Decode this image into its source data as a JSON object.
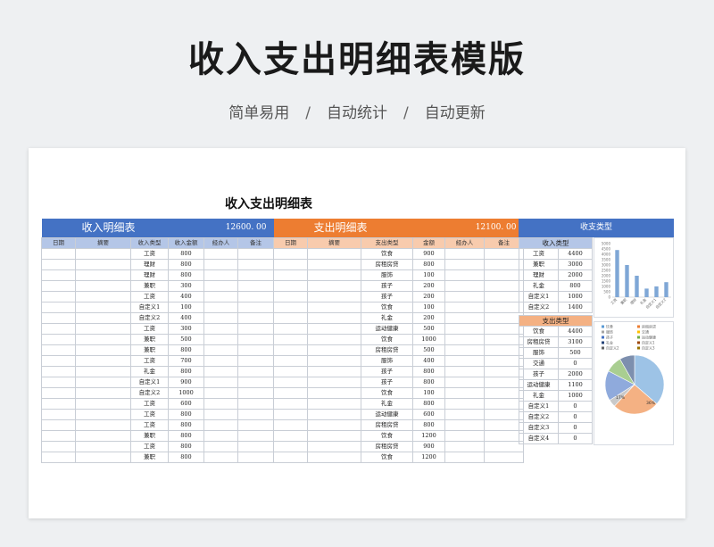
{
  "header": {
    "title": "收入支出明细表模版",
    "tags": [
      "简单易用",
      "自动统计",
      "自动更新"
    ],
    "separator": "/"
  },
  "sheet": {
    "title": "收入支出明细表"
  },
  "income": {
    "banner": "收入明细表",
    "total": "12600. 00",
    "columns": [
      "日期",
      "摘要",
      "收入类型",
      "收入金额",
      "经办人",
      "备注"
    ],
    "rows": [
      [
        "工资",
        "800"
      ],
      [
        "理财",
        "800"
      ],
      [
        "理财",
        "800"
      ],
      [
        "兼职",
        "300"
      ],
      [
        "工资",
        "400"
      ],
      [
        "自定义1",
        "100"
      ],
      [
        "自定义2",
        "400"
      ],
      [
        "工资",
        "300"
      ],
      [
        "兼职",
        "500"
      ],
      [
        "兼职",
        "800"
      ],
      [
        "工资",
        "700"
      ],
      [
        "礼金",
        "800"
      ],
      [
        "自定义1",
        "900"
      ],
      [
        "自定义2",
        "1000"
      ],
      [
        "工资",
        "600"
      ],
      [
        "工资",
        "800"
      ],
      [
        "工资",
        "800"
      ],
      [
        "兼职",
        "800"
      ],
      [
        "工资",
        "800"
      ],
      [
        "兼职",
        "800"
      ]
    ]
  },
  "expense": {
    "banner": "支出明细表",
    "total": "12100. 00",
    "columns": [
      "日期",
      "摘要",
      "支出类型",
      "金额",
      "经办人",
      "备注"
    ],
    "rows": [
      [
        "饮食",
        "900"
      ],
      [
        "房租房贷",
        "800"
      ],
      [
        "服饰",
        "100"
      ],
      [
        "孩子",
        "200"
      ],
      [
        "孩子",
        "200"
      ],
      [
        "饮食",
        "100"
      ],
      [
        "礼金",
        "200"
      ],
      [
        "运动健康",
        "500"
      ],
      [
        "饮食",
        "1000"
      ],
      [
        "房租房贷",
        "500"
      ],
      [
        "服饰",
        "400"
      ],
      [
        "孩子",
        "800"
      ],
      [
        "孩子",
        "800"
      ],
      [
        "饮食",
        "100"
      ],
      [
        "礼金",
        "800"
      ],
      [
        "运动健康",
        "600"
      ],
      [
        "房租房贷",
        "800"
      ],
      [
        "饮食",
        "1200"
      ],
      [
        "房租房贷",
        "900"
      ],
      [
        "饮食",
        "1200"
      ]
    ]
  },
  "summary": {
    "banner": "收支类型",
    "income_label": "收入类型",
    "income_types": [
      [
        "工资",
        "4400"
      ],
      [
        "兼职",
        "3000"
      ],
      [
        "理财",
        "2000"
      ],
      [
        "礼金",
        "800"
      ],
      [
        "自定义1",
        "1000"
      ],
      [
        "自定义2",
        "1400"
      ]
    ],
    "expense_label": "支出类型",
    "expense_types": [
      [
        "饮食",
        "4400"
      ],
      [
        "房租房贷",
        "3100"
      ],
      [
        "服饰",
        "500"
      ],
      [
        "交通",
        "0"
      ],
      [
        "孩子",
        "2000"
      ],
      [
        "运动健康",
        "1100"
      ],
      [
        "礼金",
        "1000"
      ],
      [
        "自定义1",
        "0"
      ],
      [
        "自定义2",
        "0"
      ],
      [
        "自定义3",
        "0"
      ],
      [
        "自定义4",
        "0"
      ]
    ]
  },
  "chart_data": [
    {
      "type": "bar",
      "categories": [
        "工资",
        "兼职",
        "理财",
        "礼金",
        "自定义1",
        "自定义2"
      ],
      "values": [
        4400,
        3000,
        2000,
        800,
        1000,
        1400
      ],
      "ylim": [
        0,
        5000
      ],
      "yticks": [
        "5000",
        "4500",
        "4000",
        "3500",
        "3000",
        "2500",
        "2000",
        "1500",
        "1000",
        "500",
        "0"
      ],
      "color": "#7fa7d6"
    },
    {
      "type": "pie",
      "legend": [
        "饮食",
        "房租房贷",
        "服饰",
        "交通",
        "孩子",
        "运动健康",
        "礼金",
        "自定义1",
        "自定义2",
        "自定义3"
      ],
      "values": [
        4400,
        3100,
        500,
        0,
        2000,
        1100,
        1000,
        0,
        0,
        0
      ],
      "colors": [
        "#5b9bd5",
        "#ed7d31",
        "#a5a5a5",
        "#ffc000",
        "#4472c4",
        "#70ad47",
        "#264478",
        "#9e480e",
        "#636363",
        "#997300"
      ],
      "visible_labels": [
        "17%",
        "36%"
      ]
    }
  ]
}
